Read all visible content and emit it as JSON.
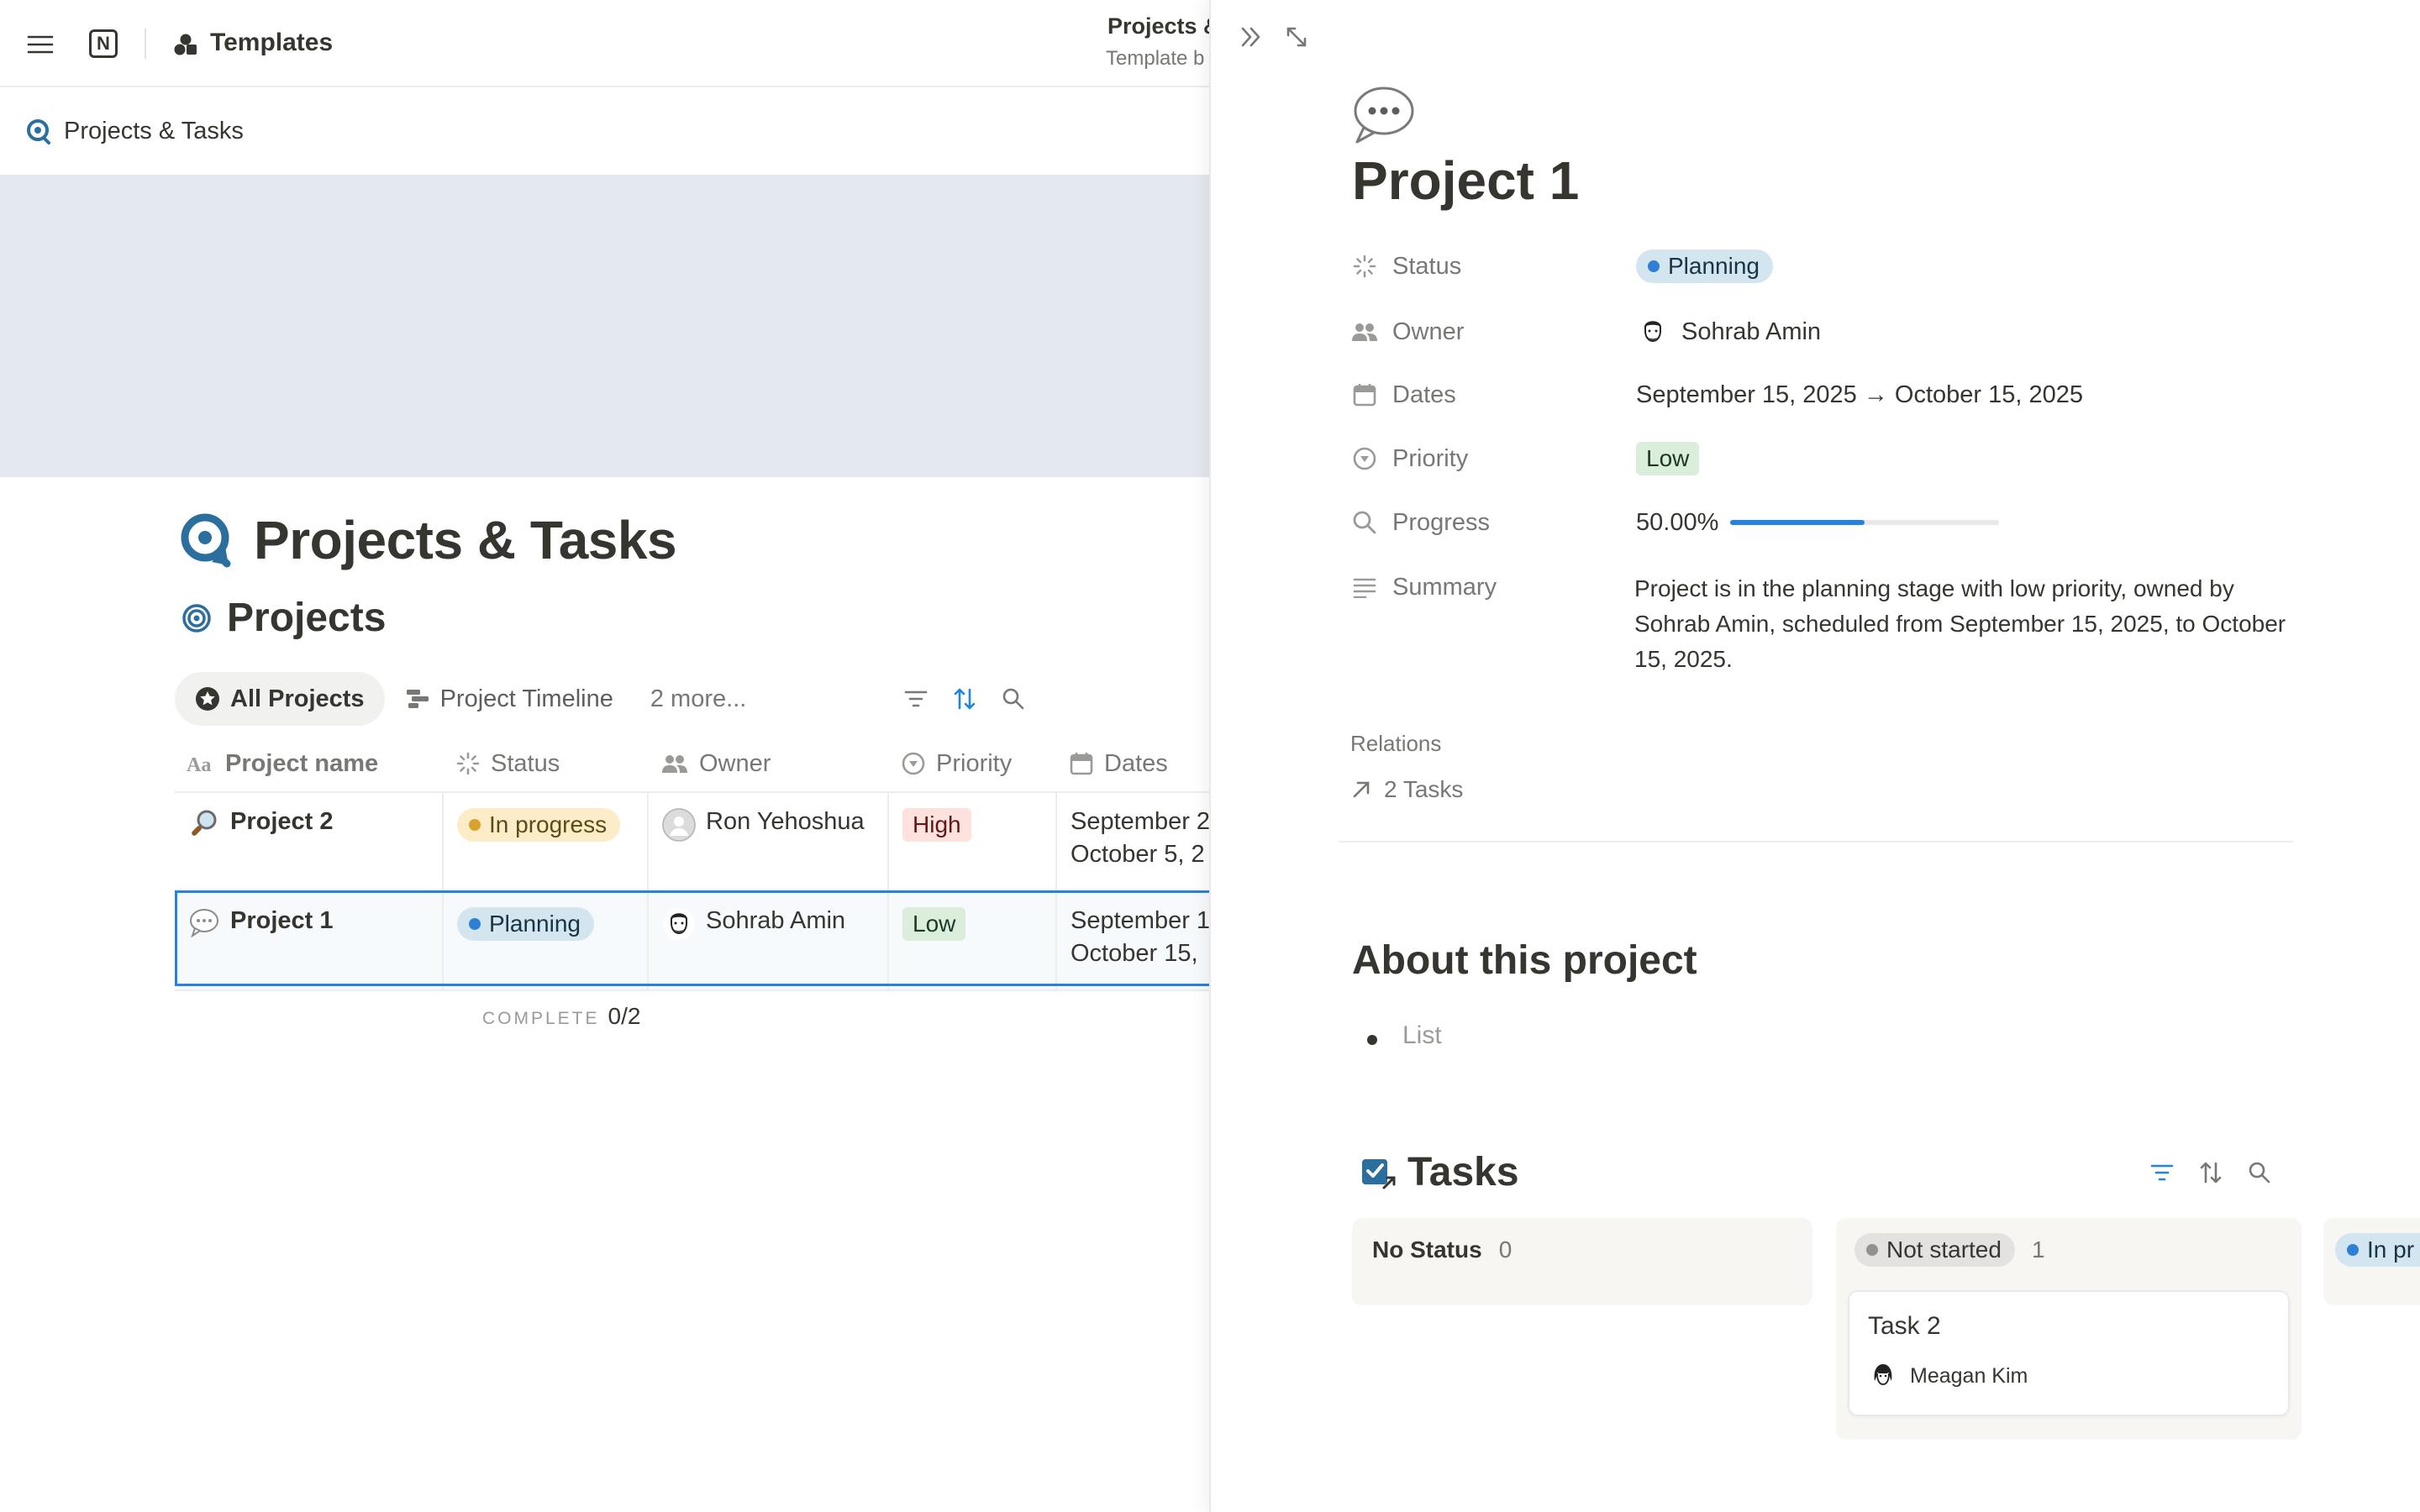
{
  "topbar": {
    "workspace_label": "Templates",
    "page_title": "Projects &",
    "page_subtitle": "Template b"
  },
  "breadcrumb": {
    "label": "Projects & Tasks"
  },
  "page": {
    "title": "Projects & Tasks",
    "database_title": "Projects"
  },
  "views": {
    "tabs": [
      {
        "label": "All Projects",
        "icon": "star-circle-icon",
        "active": true
      },
      {
        "label": "Project Timeline",
        "icon": "timeline-icon",
        "active": false
      }
    ],
    "more_label": "2 more..."
  },
  "table": {
    "columns": [
      {
        "label": "Project name",
        "icon": "text-aa-icon"
      },
      {
        "label": "Status",
        "icon": "status-spinner-icon"
      },
      {
        "label": "Owner",
        "icon": "people-icon"
      },
      {
        "label": "Priority",
        "icon": "priority-icon"
      },
      {
        "label": "Dates",
        "icon": "calendar-icon"
      }
    ],
    "rows": [
      {
        "icon": "magnifier-emoji-icon",
        "name": "Project 2",
        "status": "In progress",
        "owner": "Ron Yehoshua",
        "priority": "High",
        "dates_line1": "September 2",
        "dates_line2": "October 5, 2"
      },
      {
        "icon": "speech-bubble-emoji-icon",
        "name": "Project 1",
        "status": "Planning",
        "owner": "Sohrab Amin",
        "priority": "Low",
        "dates_line1": "September 1",
        "dates_line2": "October 15,"
      }
    ],
    "footer_label": "COMPLETE",
    "footer_value": "0/2"
  },
  "peek": {
    "title": "Project 1",
    "properties": {
      "status": {
        "label": "Status",
        "value": "Planning"
      },
      "owner": {
        "label": "Owner",
        "value": "Sohrab Amin"
      },
      "dates": {
        "label": "Dates",
        "value": "September 15, 2025 → October 15, 2025"
      },
      "priority": {
        "label": "Priority",
        "value": "Low"
      },
      "progress": {
        "label": "Progress",
        "value": "50.00%",
        "fraction": 0.5
      },
      "summary": {
        "label": "Summary",
        "value": "Project is in the planning stage with low priority, owned by Sohrab Amin, scheduled from September 15, 2025, to October 15, 2025."
      }
    },
    "relations": {
      "label": "Relations",
      "item": "2 Tasks"
    },
    "about_heading": "About this project",
    "list_placeholder": "List",
    "tasks": {
      "heading": "Tasks",
      "columns": [
        {
          "name": "No Status",
          "count": "0"
        },
        {
          "name": "Not started",
          "count": "1",
          "card": {
            "title": "Task 2",
            "assignee": "Meagan Kim"
          }
        },
        {
          "name": "In pr"
        }
      ]
    }
  },
  "colors": {
    "accent_blue": "#2383e2",
    "status_planning_bg": "#d3e5ef",
    "status_planning_dot": "#2f7fd7",
    "status_inprogress_bg": "#fdecc8",
    "status_inprogress_dot": "#d9a22a",
    "priority_high_bg": "#ffe2dd",
    "priority_low_bg": "#dbeddb",
    "not_started_bg": "#e3e2e0",
    "cover": "#e3e9ef"
  }
}
